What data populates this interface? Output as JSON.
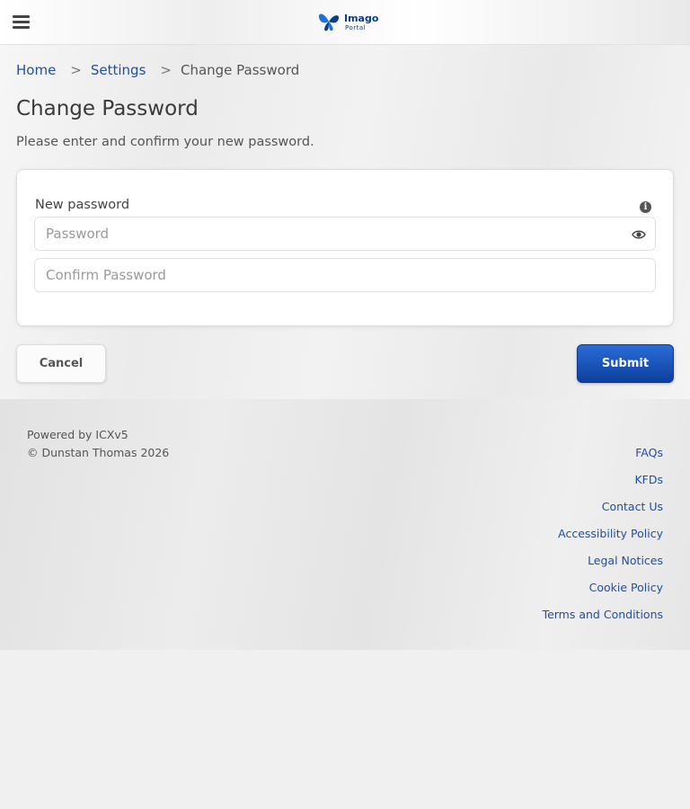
{
  "header": {
    "logo_name": "Imago",
    "logo_sub": "Portal"
  },
  "breadcrumb": {
    "home": "Home",
    "settings": "Settings",
    "separator": ">",
    "current": "Change Password"
  },
  "page": {
    "title": "Change Password",
    "subtitle": "Please enter and confirm your new password."
  },
  "form": {
    "new_password_label": "New password",
    "password_placeholder": "Password",
    "password_value": "",
    "confirm_placeholder": "Confirm Password",
    "confirm_value": "",
    "info_icon": "info-circle-icon",
    "toggle_icon": "eye-icon"
  },
  "actions": {
    "cancel_label": "Cancel",
    "submit_label": "Submit"
  },
  "footer": {
    "powered_by": "Powered by ICXv5",
    "copyright": "© Dunstan Thomas 2026",
    "links": [
      "FAQs",
      "KFDs",
      "Contact Us",
      "Accessibility Policy",
      "Legal Notices",
      "Cookie Policy",
      "Terms and Conditions"
    ]
  },
  "colors": {
    "brand": "#0b3c8c",
    "link": "#1f4fa0",
    "submit": "#1a52b8"
  }
}
